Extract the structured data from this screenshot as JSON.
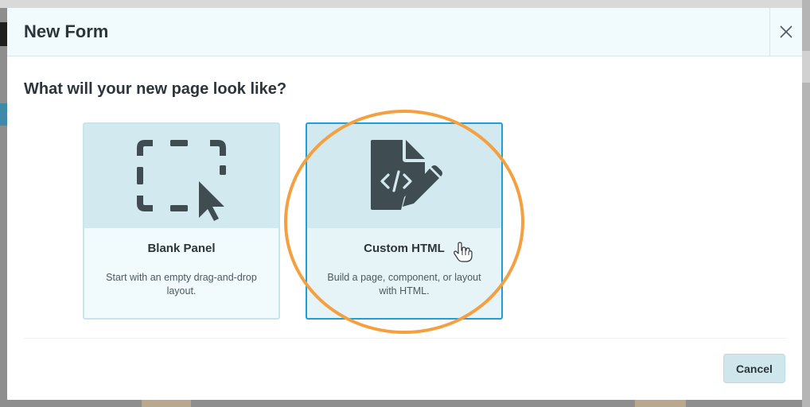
{
  "modal": {
    "title": "New Form",
    "question": "What will your new page look like?",
    "cancel_label": "Cancel"
  },
  "cards": [
    {
      "title": "Blank Panel",
      "description": "Start with an empty drag-and-drop layout.",
      "icon": "dashed-selection-cursor-icon"
    },
    {
      "title": "Custom HTML",
      "description": "Build a page, component, or layout with HTML.",
      "icon": "code-file-pencil-icon",
      "selected": true
    }
  ],
  "colors": {
    "accent": "#1e9fd9",
    "highlight_circle": "#f5a040",
    "header_bg": "#f1fafd",
    "icon": "#3f4d53",
    "cancel_bg": "#cfe6ed"
  }
}
